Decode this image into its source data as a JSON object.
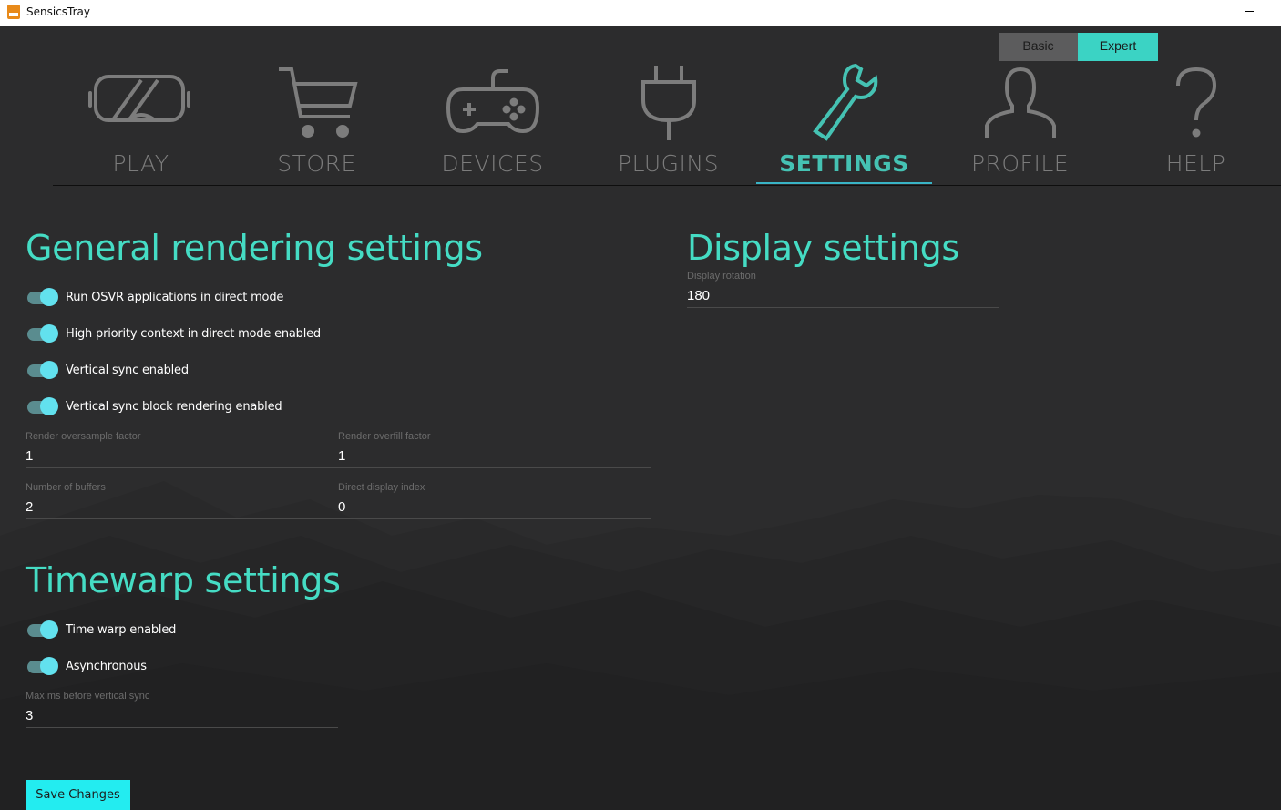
{
  "window": {
    "title": "SensicsTray"
  },
  "mode_toggle": {
    "basic_label": "Basic",
    "expert_label": "Expert",
    "selected": "Expert"
  },
  "nav": {
    "items": [
      {
        "label": "PLAY",
        "icon": "vr-headset-icon"
      },
      {
        "label": "STORE",
        "icon": "cart-icon"
      },
      {
        "label": "DEVICES",
        "icon": "gamepad-icon"
      },
      {
        "label": "PLUGINS",
        "icon": "plug-icon"
      },
      {
        "label": "SETTINGS",
        "icon": "wrench-icon",
        "active": true
      },
      {
        "label": "PROFILE",
        "icon": "person-icon"
      },
      {
        "label": "HELP",
        "icon": "question-icon"
      }
    ]
  },
  "general": {
    "title": "General rendering settings",
    "toggles": [
      {
        "label": "Run OSVR applications in direct mode",
        "on": true
      },
      {
        "label": "High priority context in direct mode enabled",
        "on": true
      },
      {
        "label": "Vertical sync enabled",
        "on": true
      },
      {
        "label": "Vertical sync block rendering enabled",
        "on": true
      }
    ],
    "fields": {
      "oversample": {
        "label": "Render oversample factor",
        "value": "1"
      },
      "overfill": {
        "label": "Render overfill factor",
        "value": "1"
      },
      "buffers": {
        "label": "Number of buffers",
        "value": "2"
      },
      "display_index": {
        "label": "Direct display index",
        "value": "0"
      }
    }
  },
  "display": {
    "title": "Display settings",
    "rotation": {
      "label": "Display rotation",
      "value": "180"
    }
  },
  "timewarp": {
    "title": "Timewarp settings",
    "toggles": [
      {
        "label": "Time warp enabled",
        "on": true
      },
      {
        "label": "Asynchronous",
        "on": true
      }
    ],
    "max_ms": {
      "label": "Max ms before vertical sync",
      "value": "3"
    }
  },
  "save_label": "Save Changes",
  "colors": {
    "accent": "#45dcc4",
    "toggle_knob": "#62e1ee",
    "save_button": "#23ecf0",
    "background": "#2c2c2d"
  }
}
